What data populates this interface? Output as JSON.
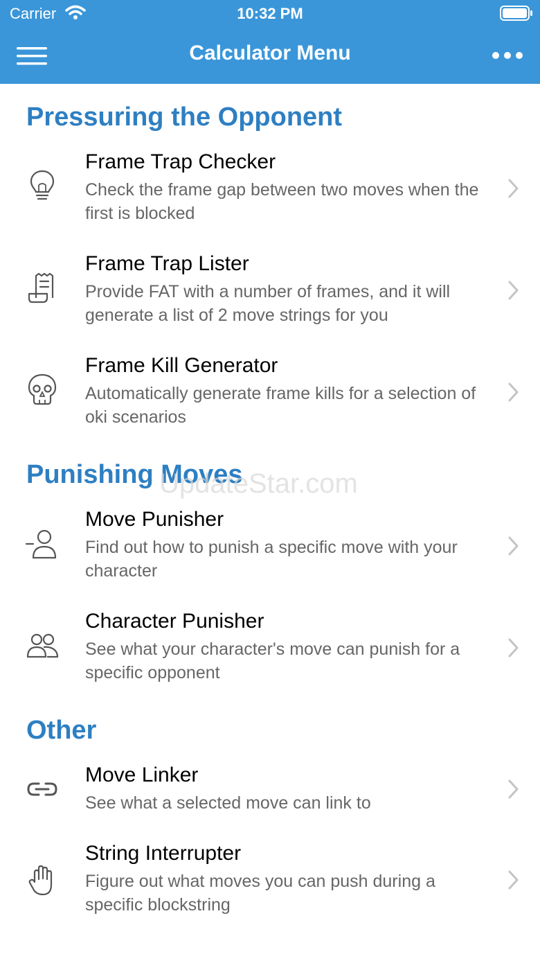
{
  "status_bar": {
    "carrier": "Carrier",
    "time": "10:32 PM"
  },
  "nav": {
    "title": "Calculator Menu",
    "menu_icon": "hamburger-menu-icon",
    "more_icon": "more-dots-icon"
  },
  "sections": [
    {
      "title": "Pressuring the Opponent",
      "items": [
        {
          "title": "Frame Trap Checker",
          "subtitle": "Check the frame gap between two moves when the first is blocked",
          "icon": "lightbulb-icon"
        },
        {
          "title": "Frame Trap Lister",
          "subtitle": "Provide FAT with a number of frames, and it will generate a list of 2 move strings for you",
          "icon": "receipt-list-icon"
        },
        {
          "title": "Frame Kill Generator",
          "subtitle": "Automatically generate frame kills for a selection of oki scenarios",
          "icon": "skull-icon"
        }
      ]
    },
    {
      "title": "Punishing Moves",
      "items": [
        {
          "title": "Move Punisher",
          "subtitle": "Find out how to punish a specific move with your character",
          "icon": "user-minus-icon"
        },
        {
          "title": "Character Punisher",
          "subtitle": "See what your character's move can punish for a specific opponent",
          "icon": "users-icon"
        }
      ]
    },
    {
      "title": "Other",
      "items": [
        {
          "title": "Move Linker",
          "subtitle": "See what a selected move can link to",
          "icon": "link-icon"
        },
        {
          "title": "String Interrupter",
          "subtitle": "Figure out what moves you can push during a specific blockstring",
          "icon": "hand-icon"
        }
      ]
    }
  ],
  "watermark": "UpdateStar.com",
  "colors": {
    "header_bg": "#3a96d9",
    "section_title": "#2e7fc2",
    "subtitle_text": "#666666"
  }
}
